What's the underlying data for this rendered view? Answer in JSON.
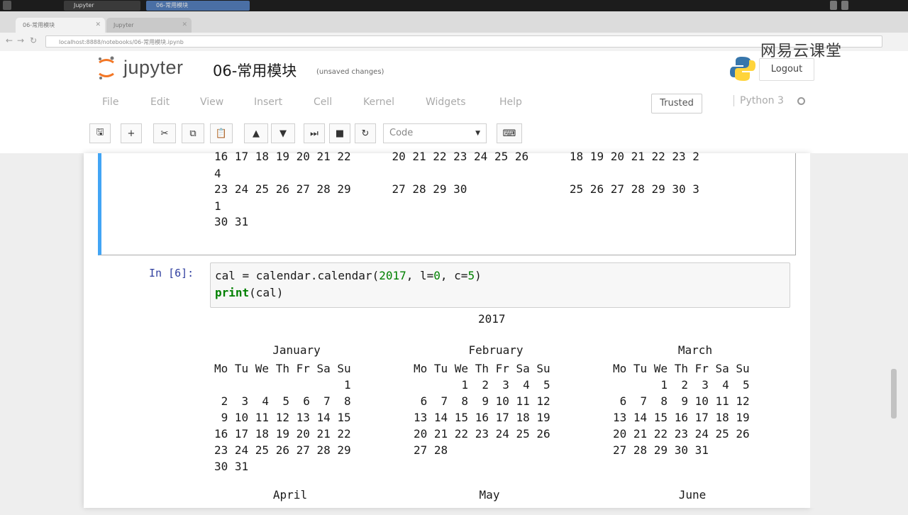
{
  "browser": {
    "tabs": [
      "06-常用模块",
      "Jupyter"
    ],
    "url": "localhost:8888/notebooks/06-常用模块.ipynb"
  },
  "header": {
    "logo_text": "jupyter",
    "notebook_title": "06-常用模块",
    "save_status": "(unsaved changes)",
    "logout_label": "Logout",
    "watermark": "网易云课堂"
  },
  "menubar": {
    "items": [
      "File",
      "Edit",
      "View",
      "Insert",
      "Cell",
      "Kernel",
      "Widgets",
      "Help"
    ],
    "trusted_label": "Trusted",
    "kernel_name": "Python 3"
  },
  "toolbar": {
    "cell_type": "Code"
  },
  "prev_output": {
    "lines": [
      "16 17 18 19 20 21 22      20 21 22 23 24 25 26      18 19 20 21 22 23 2",
      "4",
      "23 24 25 26 27 28 29      27 28 29 30               25 26 27 28 29 30 3",
      "1",
      "30 31"
    ]
  },
  "cell": {
    "prompt": "In [6]:",
    "code": {
      "line1_var": "cal",
      "line1_eq": " = calendar.calendar(",
      "line1_year": "2017",
      "line1_args_a": ", l=",
      "line1_l": "0",
      "line1_args_b": ", c=",
      "line1_c": "5",
      "line1_close": ")",
      "line2_print": "print",
      "line2_rest": "(cal)"
    }
  },
  "calendar_output": {
    "year": "2017",
    "months": [
      {
        "name": "January",
        "lines": [
          "Mo Tu We Th Fr Sa Su",
          "                   1",
          " 2  3  4  5  6  7  8",
          " 9 10 11 12 13 14 15",
          "16 17 18 19 20 21 22",
          "23 24 25 26 27 28 29",
          "30 31"
        ]
      },
      {
        "name": "February",
        "lines": [
          "Mo Tu We Th Fr Sa Su",
          "       1  2  3  4  5",
          " 6  7  8  9 10 11 12",
          "13 14 15 16 17 18 19",
          "20 21 22 23 24 25 26",
          "27 28"
        ]
      },
      {
        "name": "March",
        "lines": [
          "Mo Tu We Th Fr Sa Su",
          "       1  2  3  4  5",
          " 6  7  8  9 10 11 12",
          "13 14 15 16 17 18 19",
          "20 21 22 23 24 25 26",
          "27 28 29 30 31"
        ]
      },
      {
        "name": "April",
        "lines": []
      },
      {
        "name": "May",
        "lines": []
      },
      {
        "name": "June",
        "lines": []
      }
    ]
  }
}
